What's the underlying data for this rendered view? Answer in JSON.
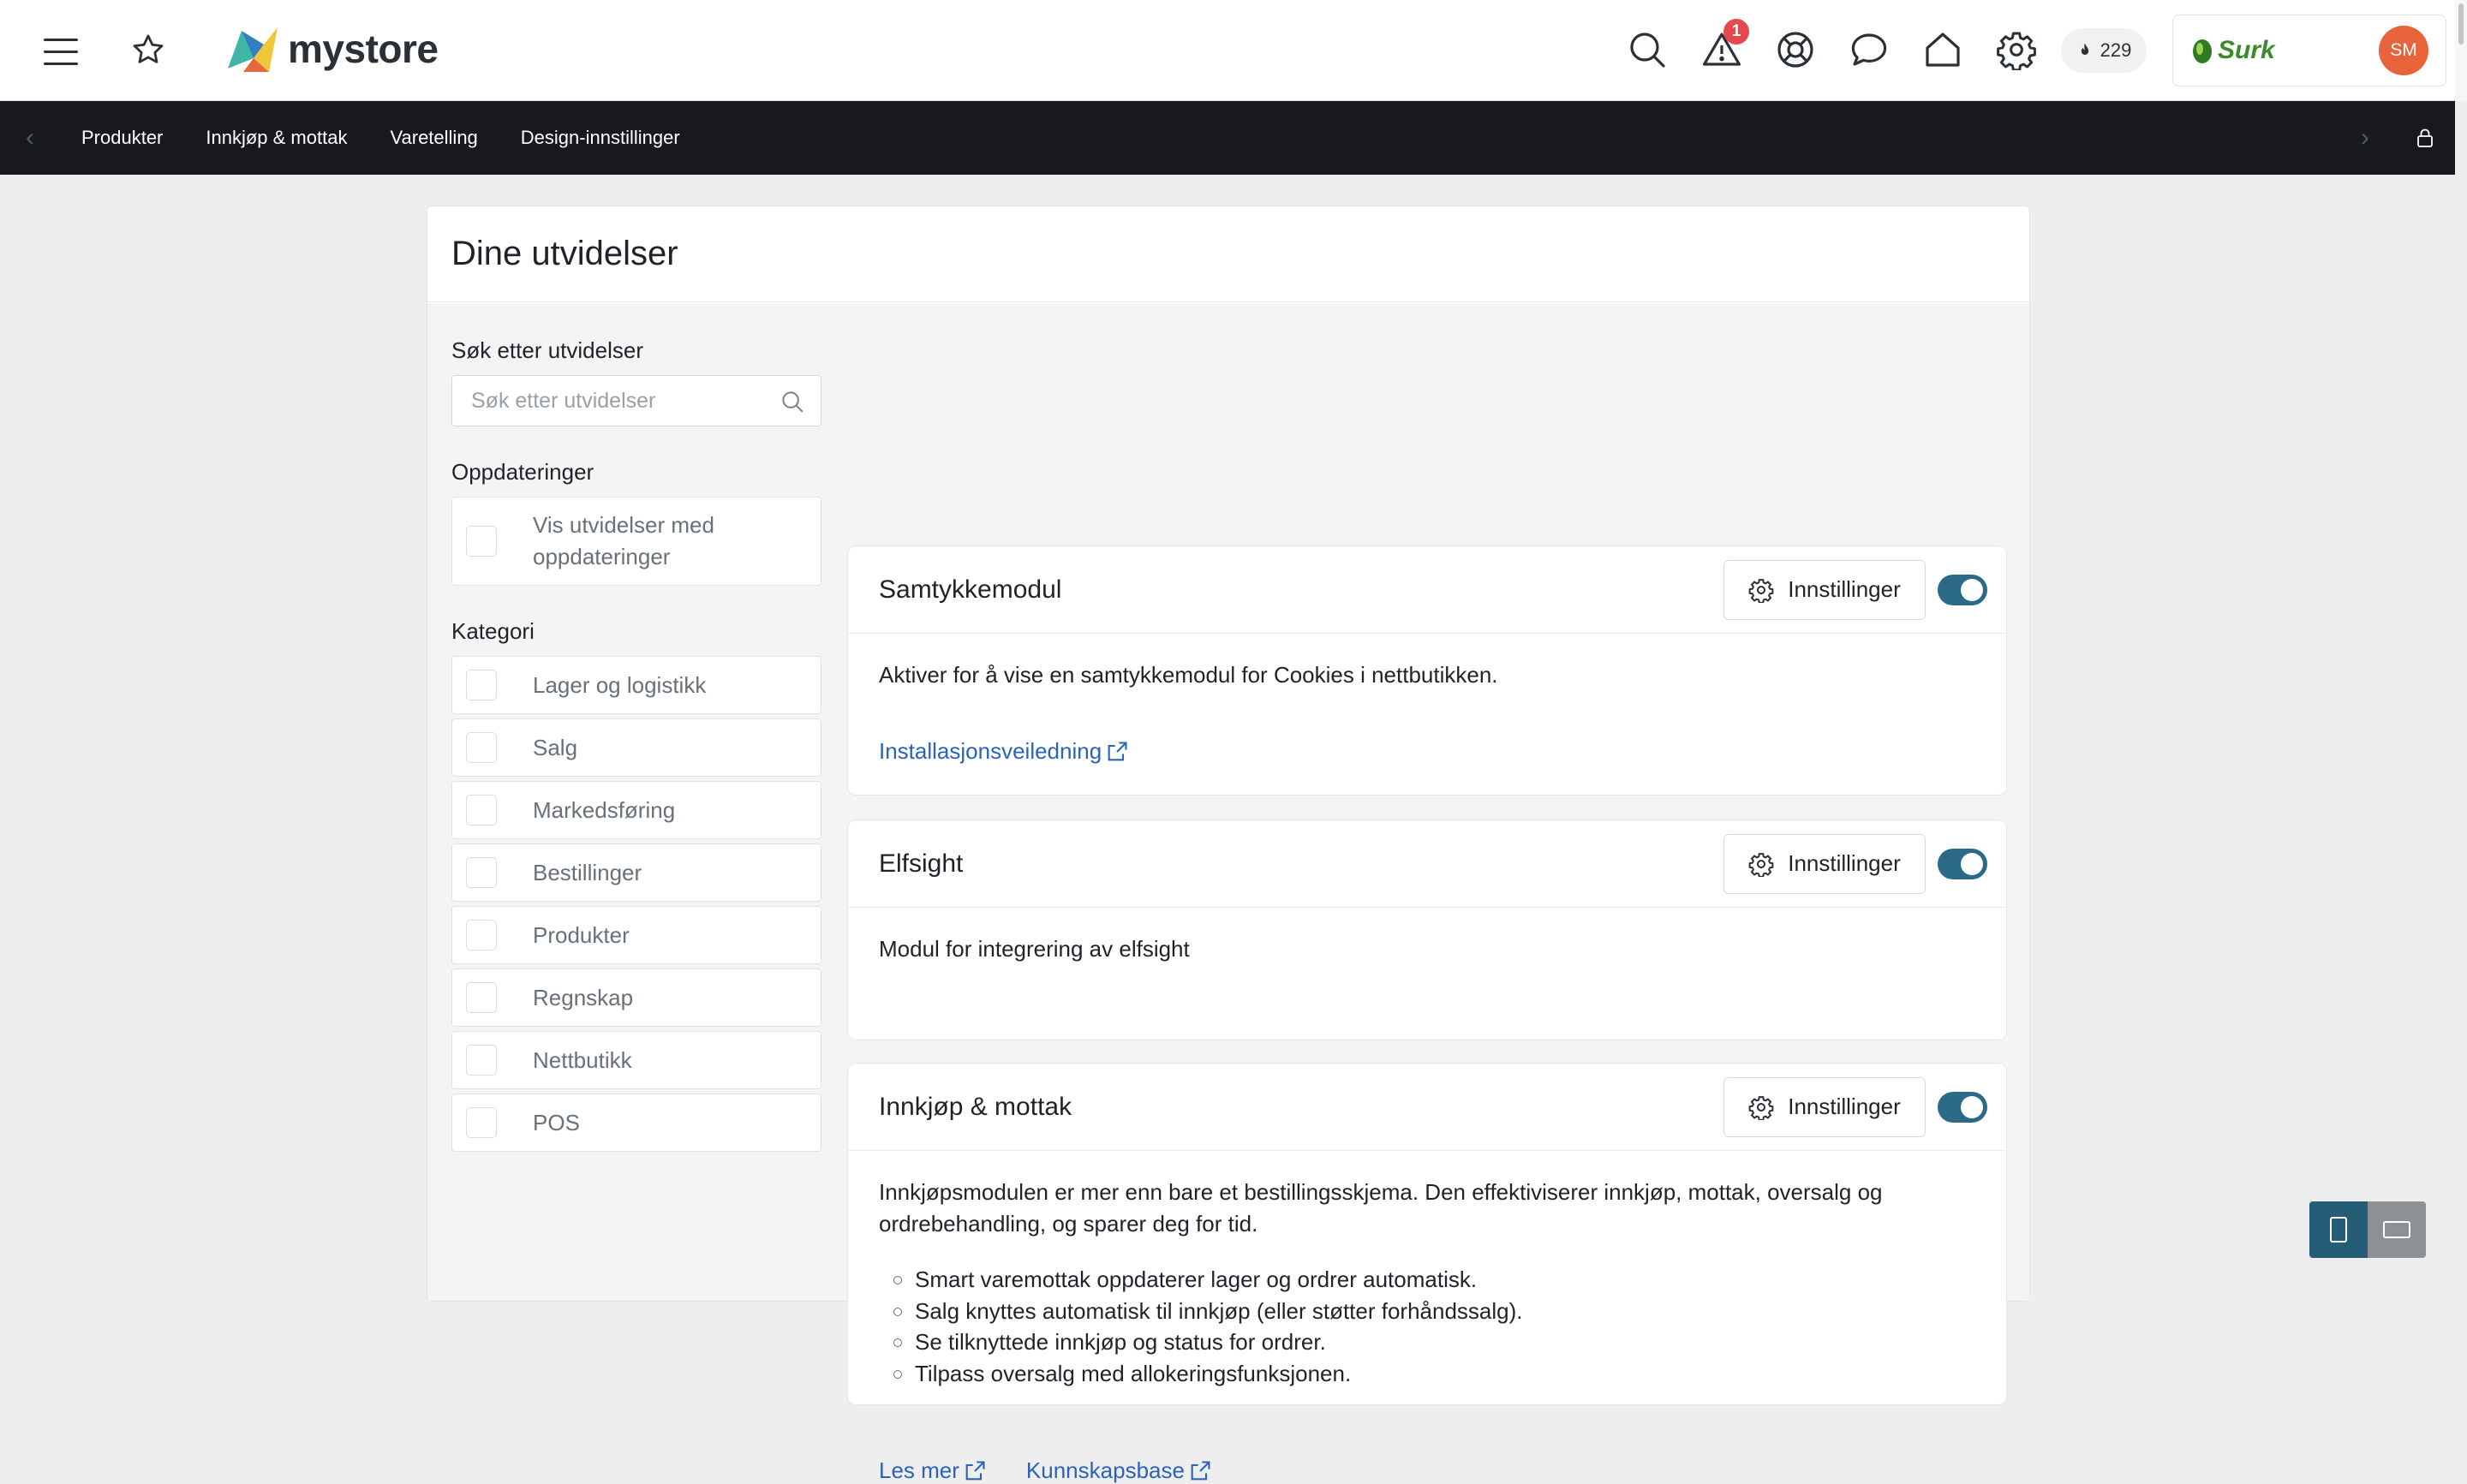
{
  "header": {
    "brand": "mystore",
    "notification_count": "1",
    "points": "229",
    "shop_logo_text": "Surk",
    "user_initials": "SM"
  },
  "nav": {
    "items": [
      "Produkter",
      "Innkjøp & mottak",
      "Varetelling",
      "Design-innstillinger"
    ]
  },
  "page": {
    "title": "Dine utvidelser"
  },
  "filters": {
    "search_label": "Søk etter utvidelser",
    "search_placeholder": "Søk etter utvidelser",
    "search_value": "",
    "updates_label": "Oppdateringer",
    "updates_option": "Vis utvidelser med oppdateringer",
    "category_label": "Kategori",
    "categories": [
      "Lager og logistikk",
      "Salg",
      "Markedsføring",
      "Bestillinger",
      "Produkter",
      "Regnskap",
      "Nettbutikk",
      "POS"
    ]
  },
  "modules": [
    {
      "title": "Samtykkemodul",
      "settings_label": "Innstillinger",
      "enabled": true,
      "description": "Aktiver for å vise en samtykkemodul for Cookies i nettbutikken.",
      "links": [
        "Installasjonsveiledning"
      ]
    },
    {
      "title": "Elfsight",
      "settings_label": "Innstillinger",
      "enabled": true,
      "description": "Modul for integrering av elfsight",
      "links": []
    },
    {
      "title": "Innkjøp & mottak",
      "settings_label": "Innstillinger",
      "enabled": true,
      "description": "Innkjøpsmodulen er mer enn bare et bestillingsskjema. Den effektiviserer innkjøp, mottak, oversalg og ordrebehandling, og sparer deg for tid.",
      "bullets": [
        "Smart varemottak oppdaterer lager og ordrer automatisk.",
        "Salg knyttes automatisk til innkjøp (eller støtter forhåndssalg).",
        "Se tilknyttede innkjøp og status for ordrer.",
        "Tilpass oversalg med allokeringsfunksjonen."
      ],
      "links": [
        "Les mer",
        "Kunnskapsbase"
      ]
    }
  ],
  "icons": {
    "menu": "hamburger-icon",
    "favorite": "star-icon",
    "search": "search-icon",
    "alerts": "warning-icon",
    "support": "lifebuoy-icon",
    "chat": "chat-icon",
    "home": "home-icon",
    "settings": "gear-icon",
    "lock": "lock-icon",
    "external": "external-link-icon"
  },
  "colors": {
    "toggle_on": "#2b6a86",
    "link": "#2a63b8",
    "badge": "#e5484d",
    "avatar": "#e8633a",
    "navbar": "#17191c"
  }
}
